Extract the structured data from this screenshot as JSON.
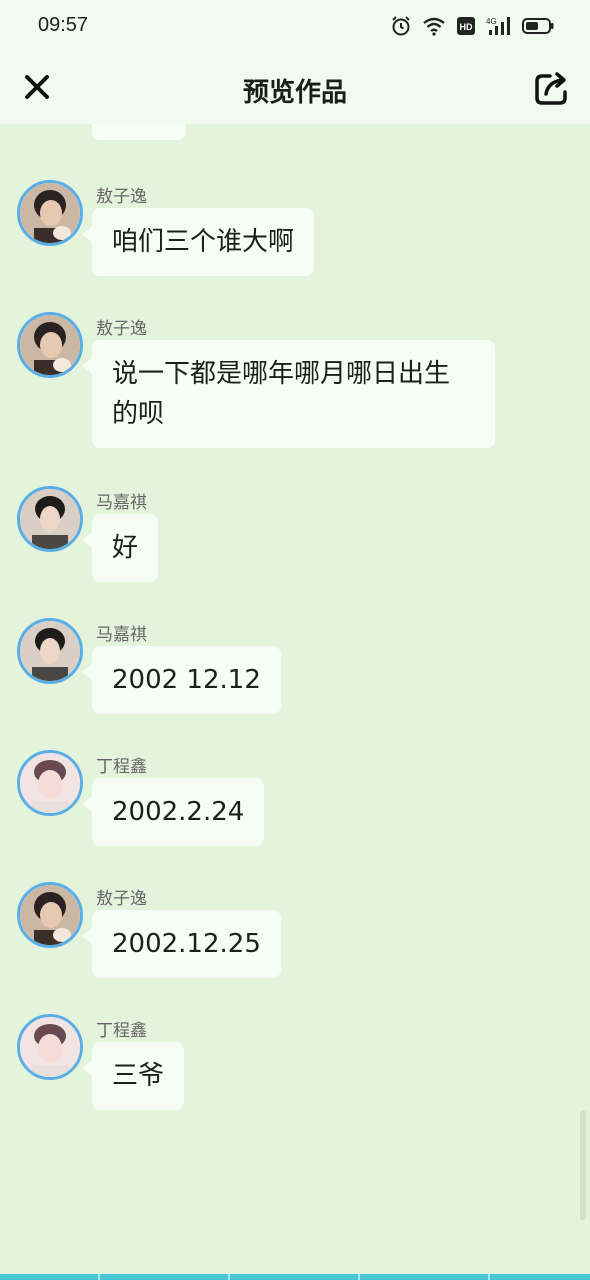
{
  "status": {
    "time": "09:57"
  },
  "header": {
    "title": "预览作品"
  },
  "icons": {
    "close": "close-icon",
    "share": "share-icon",
    "alarm": "alarm-icon",
    "wifi": "wifi-icon",
    "hd": "hd-icon",
    "signal": "signal-icon",
    "battery": "battery-icon"
  },
  "colors": {
    "background": "#e4f3dc",
    "header": "#f1faef",
    "bubble": "#f6fdf5",
    "avatar_border": "#5aaee6",
    "bottom_bar": "#49c6d4"
  },
  "messages": [
    {
      "sender": "敖子逸",
      "text": "咱们三个谁大啊"
    },
    {
      "sender": "敖子逸",
      "text": "说一下都是哪年哪月哪日出生的呗"
    },
    {
      "sender": "马嘉祺",
      "text": "好"
    },
    {
      "sender": "马嘉祺",
      "text": "2002 12.12"
    },
    {
      "sender": "丁程鑫",
      "text": "2002.2.24"
    },
    {
      "sender": "敖子逸",
      "text": "2002.12.25"
    },
    {
      "sender": "丁程鑫",
      "text": "三爷"
    }
  ]
}
